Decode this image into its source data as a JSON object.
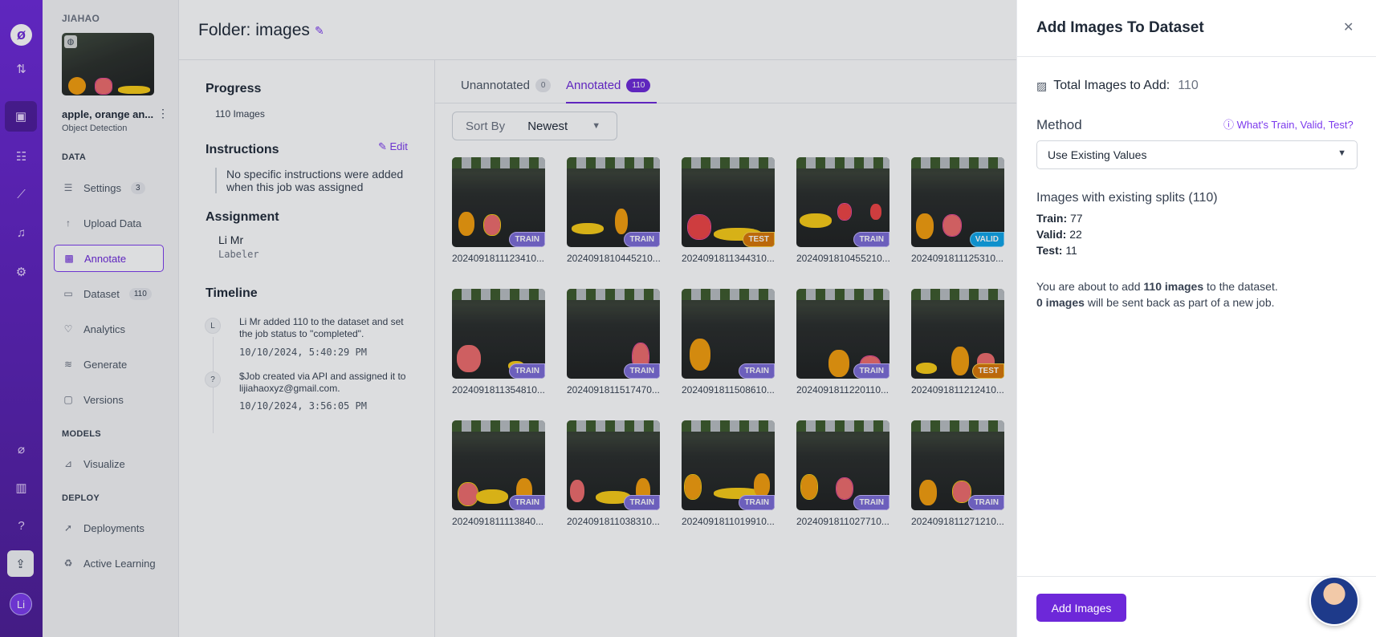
{
  "rail": {
    "icons": [
      "logo-icon",
      "transfer-icon",
      "inbox-icon",
      "hierarchy-icon",
      "chart-icon",
      "bell-icon",
      "settings-icon",
      "leaf-icon",
      "books-icon",
      "help-icon",
      "upload-icon"
    ],
    "user_initials": "Li"
  },
  "project": {
    "workspace": "JIAHAO",
    "name": "apple, orange an...",
    "type": "Object Detection",
    "sections": {
      "data": "DATA",
      "models": "MODELS",
      "deploy": "DEPLOY"
    },
    "nav": [
      {
        "label": "Settings",
        "count": "3",
        "icon": "list-icon"
      },
      {
        "label": "Upload Data",
        "icon": "upload-arrow-icon"
      },
      {
        "label": "Annotate",
        "icon": "annotate-icon",
        "active": true
      },
      {
        "label": "Dataset",
        "count": "110",
        "icon": "image-icon"
      },
      {
        "label": "Analytics",
        "icon": "analytics-icon"
      },
      {
        "label": "Generate",
        "icon": "generate-icon"
      },
      {
        "label": "Versions",
        "icon": "versions-icon"
      },
      {
        "label": "Visualize",
        "icon": "visualize-icon"
      },
      {
        "label": "Deployments",
        "icon": "rocket-icon"
      },
      {
        "label": "Active Learning",
        "icon": "recycle-icon"
      }
    ]
  },
  "folder": {
    "title": "Folder: images"
  },
  "details": {
    "progress_heading": "Progress",
    "progress_value": "110 Images",
    "instructions_heading": "Instructions",
    "edit_label": "Edit",
    "instructions_text": "No specific instructions were added when this job was assigned",
    "assignment_heading": "Assignment",
    "assignee_name": "Li Mr",
    "assignee_role": "Labeler",
    "timeline_heading": "Timeline",
    "timeline": [
      {
        "avatar": "L",
        "text": "Li Mr added 110 to the dataset and set the job status to \"completed\".",
        "time": "10/10/2024, 5:40:29 PM"
      },
      {
        "avatar": "?",
        "text": "$Job created via API and assigned it to lijiahaoxyz@gmail.com.",
        "time": "10/10/2024, 3:56:05 PM"
      }
    ]
  },
  "gallery": {
    "tabs": [
      {
        "label": "Unannotated",
        "count": "0"
      },
      {
        "label": "Annotated",
        "count": "110"
      }
    ],
    "sort_label": "Sort By",
    "sort_value": "Newest",
    "images": [
      {
        "name": "2024091811123410...",
        "split": "TRAIN"
      },
      {
        "name": "2024091810445210...",
        "split": "TRAIN"
      },
      {
        "name": "2024091811344310...",
        "split": "TEST"
      },
      {
        "name": "2024091810455210...",
        "split": "TRAIN"
      },
      {
        "name": "2024091811125310...",
        "split": "VALID"
      },
      {
        "name": "2024091811354810...",
        "split": "TRAIN"
      },
      {
        "name": "2024091811517470...",
        "split": "TRAIN"
      },
      {
        "name": "2024091811508610...",
        "split": "TRAIN"
      },
      {
        "name": "2024091811220110...",
        "split": "TRAIN"
      },
      {
        "name": "2024091811212410...",
        "split": "TEST"
      },
      {
        "name": "2024091811113840...",
        "split": "TRAIN"
      },
      {
        "name": "2024091811038310...",
        "split": "TRAIN"
      },
      {
        "name": "2024091811019910...",
        "split": "TRAIN"
      },
      {
        "name": "2024091811027710...",
        "split": "TRAIN"
      },
      {
        "name": "2024091811271210...",
        "split": "TRAIN"
      }
    ]
  },
  "drawer": {
    "title": "Add Images To Dataset",
    "total_label": "Total Images to Add:",
    "total_value": "110",
    "method_label": "Method",
    "help_link": "What's Train, Valid, Test?",
    "method_value": "Use Existing Values",
    "splits_heading": "Images with existing splits (110)",
    "splits": [
      {
        "label": "Train:",
        "value": "77"
      },
      {
        "label": "Valid:",
        "value": "22"
      },
      {
        "label": "Test:",
        "value": "11"
      }
    ],
    "msg1_pre": "You are about to add ",
    "msg1_bold": "110 images",
    "msg1_post": " to the dataset.",
    "msg2_bold": "0 images",
    "msg2_post": " will be sent back as part of a new job.",
    "add_button": "Add Images"
  }
}
